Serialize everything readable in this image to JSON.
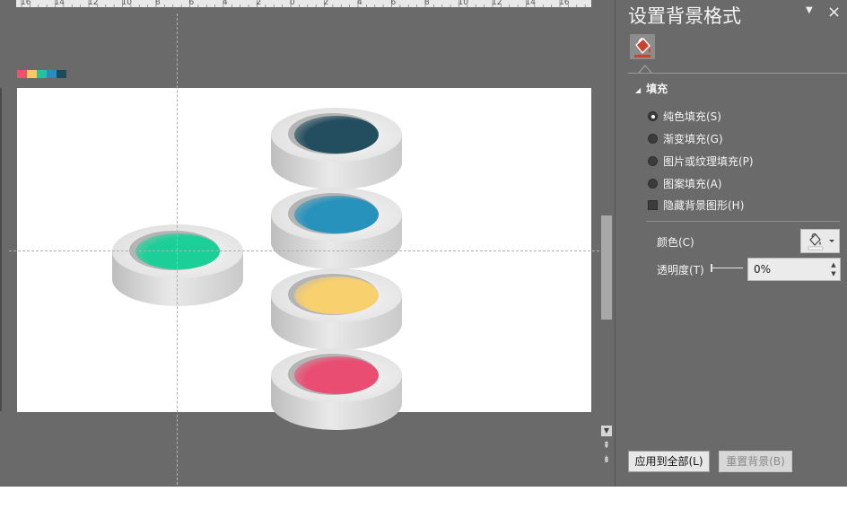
{
  "ruler": {
    "labels": [
      "16",
      "14",
      "12",
      "10",
      "8",
      "6",
      "4",
      "2",
      "0",
      "2",
      "4",
      "6",
      "8",
      "10",
      "12",
      "14",
      "16"
    ]
  },
  "swatch_colors": [
    "#f0506e",
    "#f7c96a",
    "#1fc4a0",
    "#2a8db5",
    "#1e4a5e"
  ],
  "slide": {
    "background": "#ffffff",
    "pucks": [
      {
        "name": "green-puck",
        "color": "#1ccf99"
      },
      {
        "name": "navy-puck",
        "color": "#234e60"
      },
      {
        "name": "blue-puck",
        "color": "#2792bc"
      },
      {
        "name": "yellow-puck",
        "color": "#f9d06e"
      },
      {
        "name": "pink-puck",
        "color": "#ea4d72"
      }
    ]
  },
  "pane": {
    "title": "设置背景格式",
    "section": "填充",
    "options": [
      {
        "label": "纯色填充(S)",
        "type": "radio",
        "selected": true
      },
      {
        "label": "渐变填充(G)",
        "type": "radio",
        "selected": false
      },
      {
        "label": "图片或纹理填充(P)",
        "type": "radio",
        "selected": false
      },
      {
        "label": "图案填充(A)",
        "type": "radio",
        "selected": false
      },
      {
        "label": "隐藏背景图形(H)",
        "type": "checkbox",
        "selected": false
      }
    ],
    "color_label": "颜色(C)",
    "transparency_label": "透明度(T)",
    "transparency_value": "0%",
    "apply_all_label": "应用到全部(L)",
    "reset_label": "重置背景(B)"
  }
}
